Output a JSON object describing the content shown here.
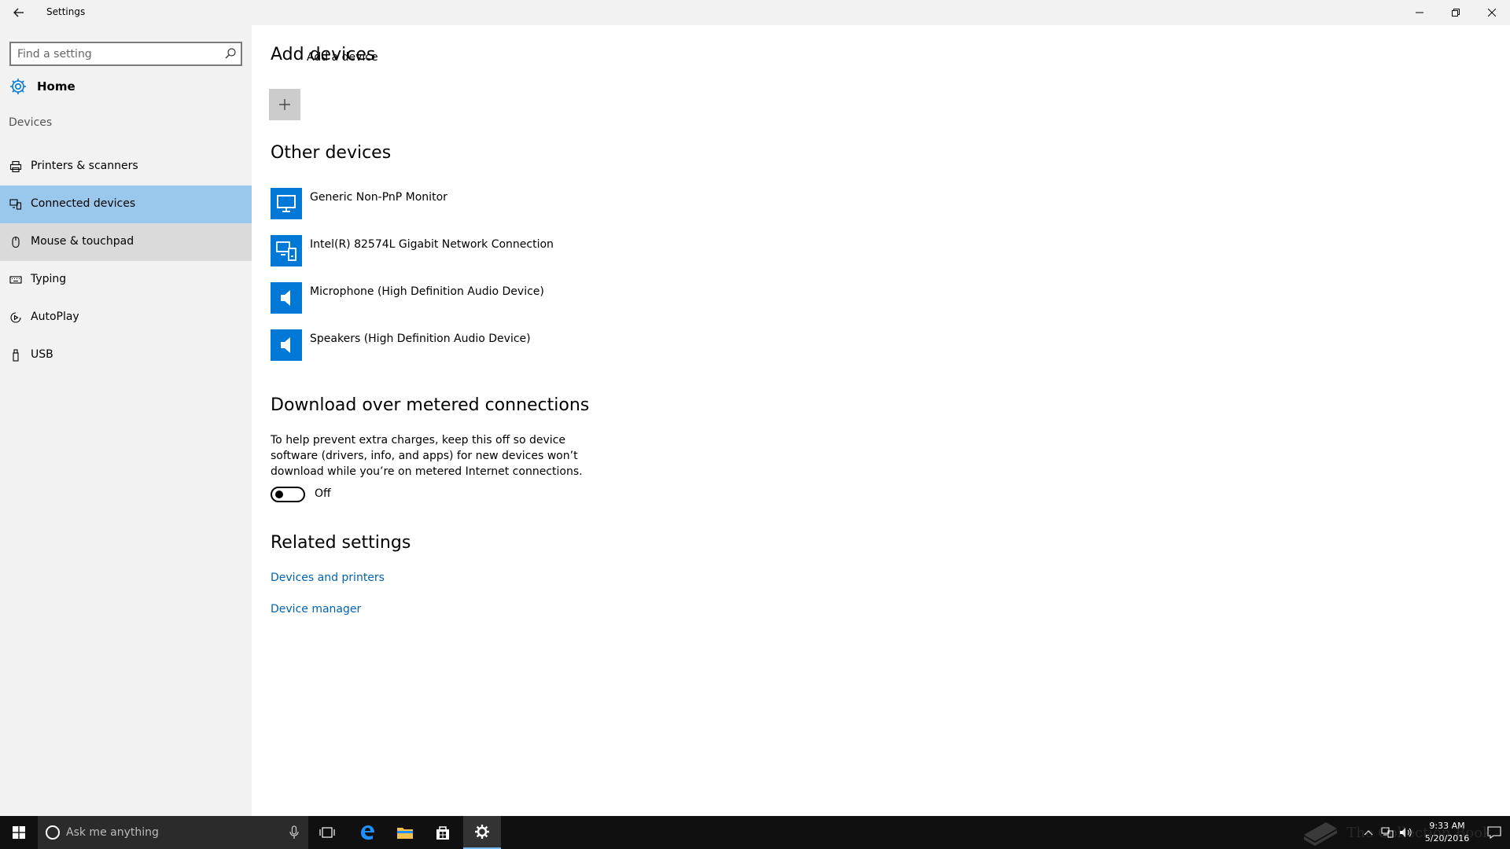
{
  "window": {
    "title": "Settings",
    "controls": [
      "minimize-icon",
      "restore-icon",
      "close-icon"
    ]
  },
  "sidebar": {
    "search_placeholder": "Find a setting",
    "home_label": "Home",
    "section_label": "Devices",
    "selected_index": 1,
    "items": [
      {
        "label": "Printers & scanners",
        "icon": "printer-icon"
      },
      {
        "label": "Connected devices",
        "icon": "connected-devices-icon"
      },
      {
        "label": "Mouse & touchpad",
        "icon": "mouse-icon"
      },
      {
        "label": "Typing",
        "icon": "keyboard-icon"
      },
      {
        "label": "AutoPlay",
        "icon": "autoplay-icon"
      },
      {
        "label": "USB",
        "icon": "usb-icon"
      }
    ]
  },
  "main": {
    "add_devices_heading": "Add devices",
    "add_device_label": "Add a device",
    "other_devices_heading": "Other devices",
    "devices": [
      {
        "name": "Generic Non-PnP Monitor",
        "icon": "monitor-icon"
      },
      {
        "name": "Intel(R) 82574L Gigabit Network Connection",
        "icon": "network-device-icon"
      },
      {
        "name": "Microphone (High Definition Audio Device)",
        "icon": "speaker-icon"
      },
      {
        "name": "Speakers (High Definition Audio Device)",
        "icon": "speaker-icon"
      }
    ],
    "metered_heading": "Download over metered connections",
    "metered_description": "To help prevent extra charges, keep this off so device software (drivers, info, and apps) for new devices won’t download while you’re on metered Internet connections.",
    "metered_toggle_state": "Off",
    "related_heading": "Related settings",
    "related_links": [
      "Devices and printers",
      "Device manager"
    ]
  },
  "taskbar": {
    "search_placeholder": "Ask me anything",
    "time": "9:33 AM",
    "date": "5/20/2016",
    "watermark": "The Collection Book"
  },
  "colors": {
    "accent": "#0078d7",
    "selected_nav": "#99c8ec",
    "hover_nav": "#dadada",
    "link": "#0063b1",
    "sidebar_bg": "#f2f2f2",
    "taskbar_bg": "#101010"
  }
}
